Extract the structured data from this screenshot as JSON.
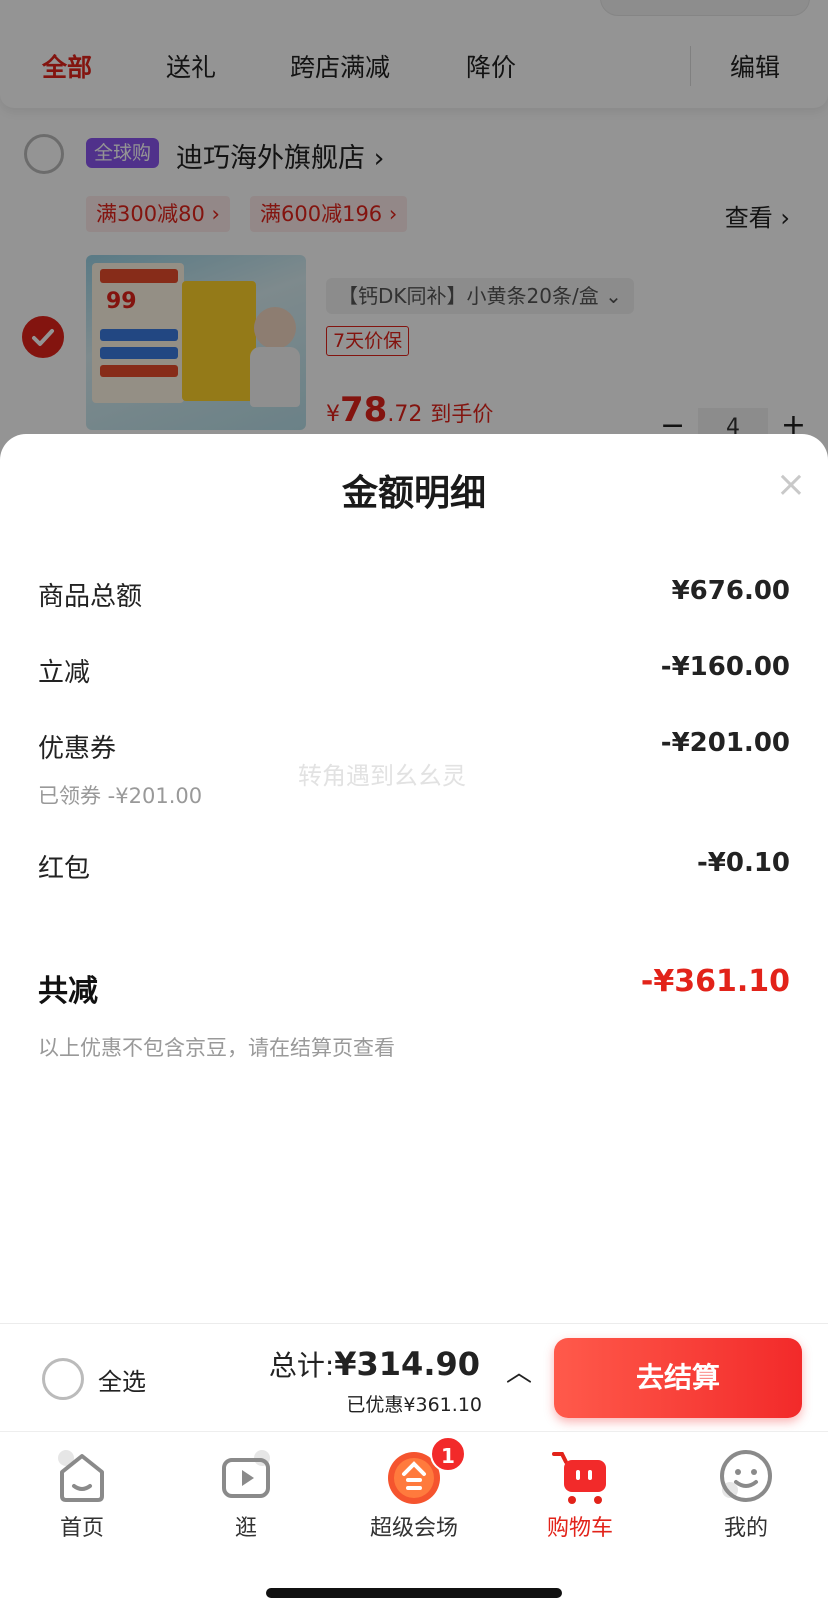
{
  "cart": {
    "tabs": [
      "全部",
      "送礼",
      "跨店满减",
      "降价"
    ],
    "edit_label": "编辑",
    "shop": {
      "tag": "全球购",
      "name": "迪巧海外旗舰店",
      "arrow": "›",
      "promos": [
        "满300减80 ›",
        "满600减196 ›"
      ],
      "view_label": "查看 ›"
    },
    "product": {
      "variant": "【钙DK同补】小黄条20条/盒",
      "variant_chevron": "⌄",
      "price_guard": "7天价保",
      "price_symbol": "¥",
      "price_int": "78",
      "price_dec": ".72",
      "price_note": "到手价",
      "quantity": "4",
      "minus": "−",
      "plus": "+"
    }
  },
  "sheet": {
    "title": "金额明细",
    "close": "×",
    "rows": [
      {
        "label": "商品总额",
        "value": "¥676.00"
      },
      {
        "label": "立减",
        "value": "-¥160.00"
      },
      {
        "label": "优惠券",
        "value": "-¥201.00",
        "sub": "已领券 -¥201.00"
      },
      {
        "label": "红包",
        "value": "-¥0.10"
      }
    ],
    "total_label": "共减",
    "total_value": "-¥361.10",
    "footnote": "以上优惠不包含京豆，请在结算页查看",
    "watermark": "转角遇到幺幺灵"
  },
  "checkout": {
    "select_all": "全选",
    "total_prefix": "总计:",
    "total_amount": "¥314.90",
    "saved": "已优惠¥361.10",
    "chevron": "︿",
    "button": "去结算"
  },
  "tabbar": {
    "items": [
      {
        "label": "首页",
        "icon": "home-icon"
      },
      {
        "label": "逛",
        "icon": "video-icon"
      },
      {
        "label": "超级会场",
        "icon": "super-venue-icon",
        "badge": "1"
      },
      {
        "label": "购物车",
        "icon": "cart-icon",
        "active": true
      },
      {
        "label": "我的",
        "icon": "smile-icon"
      }
    ]
  },
  "colors": {
    "accent": "#e2231a",
    "tag_purple": "#8a55ef",
    "button_gradient_start": "#ff5a4b",
    "button_gradient_end": "#f22a2a"
  }
}
